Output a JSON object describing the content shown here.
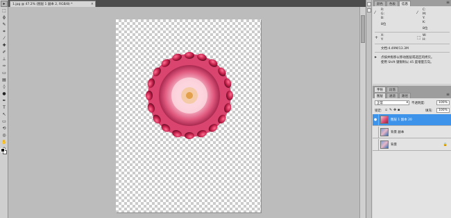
{
  "document": {
    "tab_title": "1.jpg @ 47.2% (图层 1 副本 2, RGB/8) *",
    "close_glyph": "×"
  },
  "tools": [
    {
      "icon": "move-tool-icon",
      "glyph": "▸"
    },
    {
      "icon": "marquee-tool-icon",
      "glyph": "⬚"
    },
    {
      "icon": "lasso-tool-icon",
      "glyph": "ϕ"
    },
    {
      "icon": "quick-select-tool-icon",
      "glyph": "✎"
    },
    {
      "icon": "crop-tool-icon",
      "glyph": "⌗"
    },
    {
      "icon": "eyedropper-tool-icon",
      "glyph": "⁄"
    },
    {
      "icon": "healing-brush-tool-icon",
      "glyph": "✚"
    },
    {
      "icon": "brush-tool-icon",
      "glyph": "✐"
    },
    {
      "icon": "clone-stamp-tool-icon",
      "glyph": "⊥"
    },
    {
      "icon": "history-brush-tool-icon",
      "glyph": "✑"
    },
    {
      "icon": "eraser-tool-icon",
      "glyph": "▭"
    },
    {
      "icon": "gradient-tool-icon",
      "glyph": "▤"
    },
    {
      "icon": "blur-tool-icon",
      "glyph": "◊"
    },
    {
      "icon": "dodge-tool-icon",
      "glyph": "●"
    },
    {
      "icon": "pen-tool-icon",
      "glyph": "✒"
    },
    {
      "icon": "type-tool-icon",
      "glyph": "T"
    },
    {
      "icon": "path-select-tool-icon",
      "glyph": "↖"
    },
    {
      "icon": "shape-tool-icon",
      "glyph": "▭"
    },
    {
      "icon": "3d-rotate-tool-icon",
      "glyph": "⟲"
    },
    {
      "icon": "3d-orbit-tool-icon",
      "glyph": "◎"
    },
    {
      "icon": "hand-tool-icon",
      "glyph": "✋"
    },
    {
      "icon": "zoom-tool-icon",
      "glyph": "⚲"
    }
  ],
  "info_panel": {
    "tabs": [
      "颜色",
      "色板",
      "信息"
    ],
    "active_tab": 2,
    "r": "R:",
    "g": "G:",
    "b": "B:",
    "c": "C:",
    "m": "M:",
    "y": "Y:",
    "k": "K:",
    "bit1": "8位",
    "bit2": "8位",
    "x": "X:",
    "y2": "Y:",
    "w": "W:",
    "h": "H:",
    "doc_size": "文档:4.49M/13.3M",
    "hint_line1": "点按并拖移以移动图层或选区的拷贝。",
    "hint_line2": "使用 Shift 键限制以 45 度增量方向。"
  },
  "layers_panel": {
    "tabs": [
      "图层",
      "通道",
      "路径"
    ],
    "secondary_tabs": [
      "字符",
      "段落"
    ],
    "blend_mode": "正常",
    "opacity_label": "不透明度:",
    "opacity_value": "100%",
    "lock_label": "锁定:",
    "fill_label": "填充:",
    "fill_value": "100%",
    "layers": [
      {
        "name": "图层 1 副本 20",
        "selected": true,
        "eye": "●",
        "locked": false
      },
      {
        "name": "背景 副本",
        "selected": false,
        "eye": "",
        "locked": false
      },
      {
        "name": "背景",
        "selected": false,
        "eye": "",
        "locked": true
      }
    ],
    "lock_glyph": "🔒"
  },
  "colors": {
    "selection": "#3d92ea",
    "canvas_gray": "#bcbcbc",
    "flower_pink": "#d9456f",
    "bud_red": "#c21f4a"
  }
}
